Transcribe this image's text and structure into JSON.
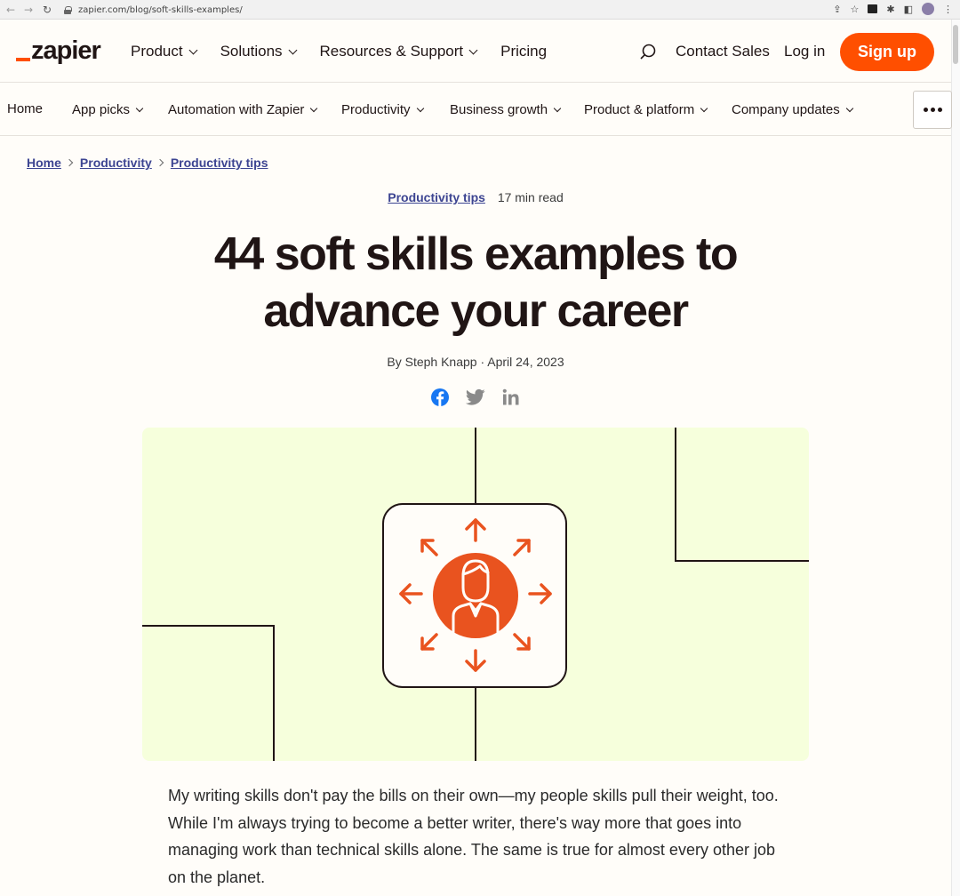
{
  "browser": {
    "url": "zapier.com/blog/soft-skills-examples/",
    "back": "←",
    "forward": "→",
    "reload": "↻"
  },
  "header": {
    "logo_text": "zapier",
    "menu": [
      "Product",
      "Solutions",
      "Resources & Support",
      "Pricing"
    ],
    "menu_has_dropdown": [
      true,
      true,
      true,
      false
    ],
    "contact_sales": "Contact Sales",
    "login": "Log in",
    "signup": "Sign up"
  },
  "categories": {
    "items": [
      "Home",
      "App picks",
      "Automation with Zapier",
      "Productivity",
      "Business growth",
      "Product & platform",
      "Company updates"
    ],
    "has_dropdown": [
      false,
      true,
      true,
      true,
      true,
      true,
      true
    ]
  },
  "breadcrumb": [
    "Home",
    "Productivity",
    "Productivity tips"
  ],
  "article": {
    "category": "Productivity tips",
    "read_time": "17 min read",
    "title": "44 soft skills examples to advance your career",
    "byline": "By Steph Knapp · April 24, 2023",
    "intro": "My writing skills don't pay the bills on their own—my people skills pull their weight, too. While I'm always trying to become a better writer, there's way more that goes into managing work than technical skills alone. The same is true for almost every other job on the planet."
  },
  "share_icons": [
    "facebook-icon",
    "twitter-icon",
    "linkedin-icon"
  ],
  "colors": {
    "brand": "#ff4f00",
    "link": "#3d4592",
    "hero_bg": "#f6ffdc",
    "illustration": "#e9531f"
  }
}
